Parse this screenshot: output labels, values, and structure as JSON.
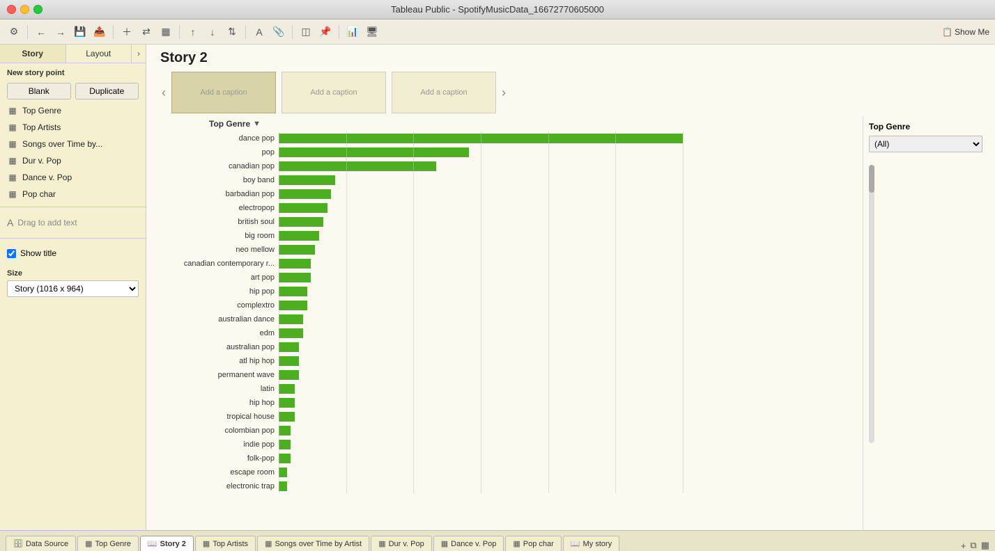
{
  "titlebar": {
    "title": "Tableau Public - SpotifyMusicData_16672770605000"
  },
  "toolbar": {
    "show_me_label": "Show Me"
  },
  "sidebar": {
    "tab_story": "Story",
    "tab_layout": "Layout",
    "new_story_point_label": "New story point",
    "blank_btn": "Blank",
    "duplicate_btn": "Duplicate",
    "items": [
      {
        "label": "Top Genre",
        "icon": "grid"
      },
      {
        "label": "Top Artists",
        "icon": "grid"
      },
      {
        "label": "Songs over Time by...",
        "icon": "grid"
      },
      {
        "label": "Dur v. Pop",
        "icon": "grid"
      },
      {
        "label": "Dance v. Pop",
        "icon": "grid"
      },
      {
        "label": "Pop char",
        "icon": "grid"
      }
    ],
    "drag_text": "Drag to add text",
    "show_title": "Show title",
    "size_label": "Size",
    "size_value": "Story (1016 x 964)"
  },
  "story": {
    "title": "Story 2",
    "captions": [
      {
        "label": "Add a caption",
        "active": true
      },
      {
        "label": "Add a caption",
        "active": false
      },
      {
        "label": "Add a caption",
        "active": false
      }
    ]
  },
  "chart": {
    "title": "Top Genre",
    "filter_label": "Top Genre",
    "filter_value": "(All)",
    "genres": [
      {
        "name": "dance pop",
        "value": 607,
        "pct": 100
      },
      {
        "name": "pop",
        "value": 290,
        "pct": 47
      },
      {
        "name": "canadian pop",
        "value": 240,
        "pct": 39
      },
      {
        "name": "boy band",
        "value": 90,
        "pct": 14
      },
      {
        "name": "barbadian pop",
        "value": 82,
        "pct": 13
      },
      {
        "name": "electropop",
        "value": 78,
        "pct": 12
      },
      {
        "name": "british soul",
        "value": 70,
        "pct": 11
      },
      {
        "name": "big room",
        "value": 62,
        "pct": 10
      },
      {
        "name": "neo mellow",
        "value": 58,
        "pct": 9
      },
      {
        "name": "canadian contemporary r...",
        "value": 52,
        "pct": 8
      },
      {
        "name": "art pop",
        "value": 48,
        "pct": 8
      },
      {
        "name": "hip pop",
        "value": 44,
        "pct": 7
      },
      {
        "name": "complextro",
        "value": 40,
        "pct": 7
      },
      {
        "name": "australian dance",
        "value": 38,
        "pct": 6
      },
      {
        "name": "edm",
        "value": 35,
        "pct": 6
      },
      {
        "name": "australian pop",
        "value": 33,
        "pct": 5
      },
      {
        "name": "atl hip hop",
        "value": 31,
        "pct": 5
      },
      {
        "name": "permanent wave",
        "value": 29,
        "pct": 5
      },
      {
        "name": "latin",
        "value": 27,
        "pct": 4
      },
      {
        "name": "hip hop",
        "value": 25,
        "pct": 4
      },
      {
        "name": "tropical house",
        "value": 23,
        "pct": 4
      },
      {
        "name": "colombian pop",
        "value": 21,
        "pct": 3
      },
      {
        "name": "indie pop",
        "value": 19,
        "pct": 3
      },
      {
        "name": "folk-pop",
        "value": 17,
        "pct": 3
      },
      {
        "name": "escape room",
        "value": 15,
        "pct": 2
      },
      {
        "name": "electronic trap",
        "value": 13,
        "pct": 2
      }
    ]
  },
  "bottom_tabs": [
    {
      "label": "Data Source",
      "icon": "db",
      "active": false
    },
    {
      "label": "Top Genre",
      "icon": "grid",
      "active": false
    },
    {
      "label": "Story 2",
      "icon": "story",
      "active": true
    },
    {
      "label": "Top Artists",
      "icon": "grid",
      "active": false
    },
    {
      "label": "Songs over Time by Artist",
      "icon": "grid",
      "active": false
    },
    {
      "label": "Dur v. Pop",
      "icon": "grid",
      "active": false
    },
    {
      "label": "Dance v. Pop",
      "icon": "grid",
      "active": false
    },
    {
      "label": "Pop char",
      "icon": "grid",
      "active": false
    },
    {
      "label": "My story",
      "icon": "story",
      "active": false
    }
  ]
}
